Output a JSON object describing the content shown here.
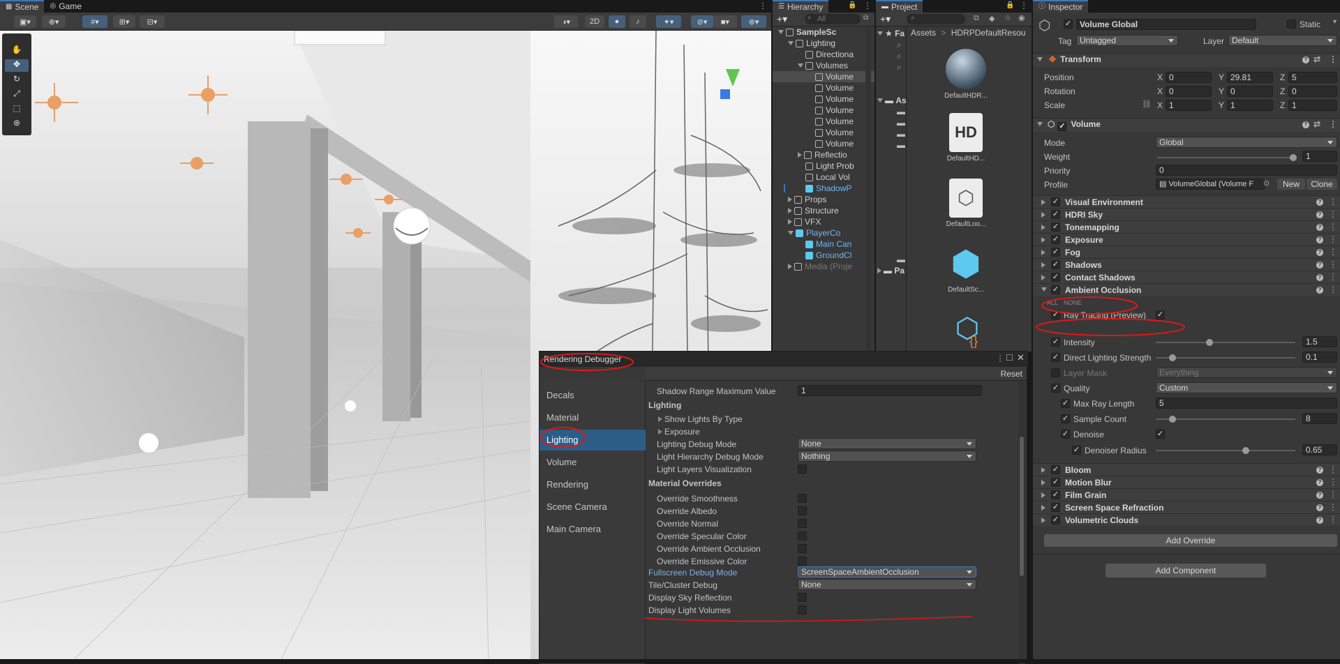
{
  "scene_tabs": {
    "scene": "Scene",
    "game": "Game"
  },
  "scene_toolbar": {
    "two_d": "2D"
  },
  "hierarchy": {
    "title": "Hierarchy",
    "search_placeholder": "All",
    "rows": [
      {
        "label": "SampleSc",
        "indent": 0,
        "exp": "down",
        "bold": true,
        "blue": false
      },
      {
        "label": "Lighting",
        "indent": 1,
        "exp": "down",
        "bold": false,
        "blue": false
      },
      {
        "label": "Directiona",
        "indent": 2,
        "exp": "",
        "bold": false,
        "blue": false
      },
      {
        "label": "Volumes",
        "indent": 2,
        "exp": "down",
        "bold": false,
        "blue": false
      },
      {
        "label": "Volume",
        "indent": 3,
        "exp": "",
        "bold": false,
        "blue": false,
        "sel": true
      },
      {
        "label": "Volume",
        "indent": 3,
        "exp": "",
        "bold": false,
        "blue": false
      },
      {
        "label": "Volume",
        "indent": 3,
        "exp": "",
        "bold": false,
        "blue": false
      },
      {
        "label": "Volume",
        "indent": 3,
        "exp": "",
        "bold": false,
        "blue": false
      },
      {
        "label": "Volume",
        "indent": 3,
        "exp": "",
        "bold": false,
        "blue": false
      },
      {
        "label": "Volume",
        "indent": 3,
        "exp": "",
        "bold": false,
        "blue": false
      },
      {
        "label": "Volume",
        "indent": 3,
        "exp": "",
        "bold": false,
        "blue": false
      },
      {
        "label": "Reflectio",
        "indent": 2,
        "exp": "right",
        "bold": false,
        "blue": false
      },
      {
        "label": "Light Prob",
        "indent": 2,
        "exp": "",
        "bold": false,
        "blue": false
      },
      {
        "label": "Local Vol",
        "indent": 2,
        "exp": "",
        "bold": false,
        "blue": false
      },
      {
        "label": "ShadowP",
        "indent": 2,
        "exp": "",
        "bold": false,
        "blue": true
      },
      {
        "label": "Props",
        "indent": 1,
        "exp": "right",
        "bold": false,
        "blue": false
      },
      {
        "label": "Structure",
        "indent": 1,
        "exp": "right",
        "bold": false,
        "blue": false
      },
      {
        "label": "VFX",
        "indent": 1,
        "exp": "right",
        "bold": false,
        "blue": false
      },
      {
        "label": "PlayerCo",
        "indent": 1,
        "exp": "down",
        "bold": false,
        "blue": true
      },
      {
        "label": "Main Can",
        "indent": 2,
        "exp": "",
        "bold": false,
        "blue": true
      },
      {
        "label": "GroundCl",
        "indent": 2,
        "exp": "",
        "bold": false,
        "blue": true
      },
      {
        "label": "Media (Proje",
        "indent": 1,
        "exp": "right",
        "bold": false,
        "blue": false,
        "dim": true
      }
    ]
  },
  "project": {
    "title": "Project",
    "breadcrumb_root": "Assets",
    "breadcrumb_sep": ">",
    "breadcrumb_folder": "HDRPDefaultResou",
    "tree_fav": "Fa",
    "tree_assets": "As",
    "tree_packages": "Pa",
    "assets": [
      "DefaultHDR...",
      "DefaultHD...",
      "DefaultLoo...",
      "DefaultSc..."
    ],
    "hd_text": "HD"
  },
  "inspector": {
    "title": "Inspector",
    "object_name": "Volume Global",
    "static_label": "Static",
    "tag_label": "Tag",
    "tag_value": "Untagged",
    "layer_label": "Layer",
    "layer_value": "Default",
    "transform": {
      "title": "Transform",
      "position_label": "Position",
      "px": "0",
      "py": "29.81",
      "pz": "5",
      "rotation_label": "Rotation",
      "rx": "0",
      "ry": "0",
      "rz": "0",
      "scale_label": "Scale",
      "sx": "1",
      "sy": "1",
      "sz": "1",
      "x": "X",
      "y": "Y",
      "z": "Z"
    },
    "volume": {
      "title": "Volume",
      "mode_label": "Mode",
      "mode_value": "Global",
      "weight_label": "Weight",
      "weight_value": "1",
      "weight_fraction": 1.0,
      "priority_label": "Priority",
      "priority_value": "0",
      "profile_label": "Profile",
      "profile_value": "VolumeGlobal (Volume F",
      "new_label": "New",
      "clone_label": "Clone"
    },
    "overrides": [
      "Visual Environment",
      "HDRI Sky",
      "Tonemapping",
      "Exposure",
      "Fog",
      "Shadows",
      "Contact Shadows",
      "Ambient Occlusion"
    ],
    "ao": {
      "all": "ALL",
      "none": "NONE",
      "ray_tracing": "Ray Tracing (Preview)",
      "intensity_label": "Intensity",
      "intensity_value": "1.5",
      "intensity_fraction": 0.38,
      "dls_label": "Direct Lighting Strength",
      "dls_value": "0.1",
      "dls_fraction": 0.1,
      "layer_mask_label": "Layer Mask",
      "layer_mask_value": "Everything",
      "quality_label": "Quality",
      "quality_value": "Custom",
      "max_ray_label": "Max Ray Length",
      "max_ray_value": "5",
      "sample_label": "Sample Count",
      "sample_value": "8",
      "sample_fraction": 0.1,
      "denoise_label": "Denoise",
      "denoiser_radius_label": "Denoiser Radius",
      "denoiser_radius_value": "0.65",
      "denoiser_radius_fraction": 0.65
    },
    "overrides2": [
      "Bloom",
      "Motion Blur",
      "Film Grain",
      "Screen Space Refraction",
      "Volumetric Clouds"
    ],
    "add_override": "Add Override",
    "add_component": "Add Component"
  },
  "debugger": {
    "title": "Rendering Debugger",
    "reset": "Reset",
    "nav": [
      "Decals",
      "Material",
      "Lighting",
      "Volume",
      "Rendering",
      "Scene Camera",
      "Main Camera"
    ],
    "shadow_range_label": "Shadow Range Maximum Value",
    "shadow_range_value": "1",
    "lighting_header": "Lighting",
    "show_lights": "Show Lights By Type",
    "exposure": "Exposure",
    "lighting_debug_mode_label": "Lighting Debug Mode",
    "lighting_debug_mode_value": "None",
    "light_hier_label": "Light Hierarchy Debug Mode",
    "light_hier_value": "Nothing",
    "light_layers_label": "Light Layers Visualization",
    "material_overrides_header": "Material Overrides",
    "mo_items": [
      "Override Smoothness",
      "Override Albedo",
      "Override Normal",
      "Override Specular Color",
      "Override Ambient Occlusion",
      "Override Emissive Color"
    ],
    "fullscreen_label": "Fullscreen Debug Mode",
    "fullscreen_value": "ScreenSpaceAmbientOcclusion",
    "tile_label": "Tile/Cluster Debug",
    "tile_value": "None",
    "sky_refl_label": "Display Sky Reflection",
    "light_volumes_label": "Display Light Volumes"
  },
  "colors": {
    "accent": "#3a79bb",
    "selection": "#2c5d87",
    "annotation": "#e01818"
  }
}
